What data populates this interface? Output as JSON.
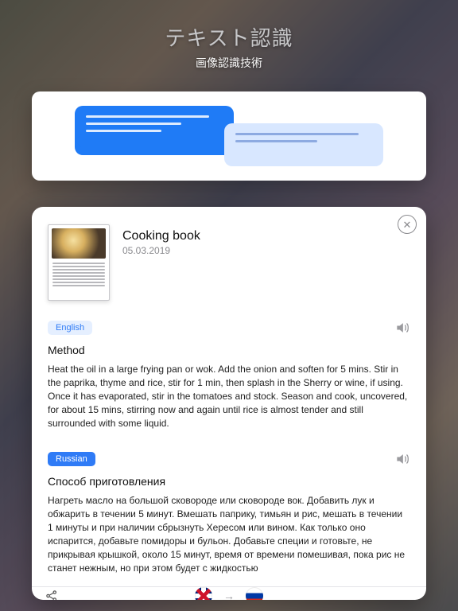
{
  "hero": {
    "title": "テキスト認識",
    "subtitle": "画像認識技術"
  },
  "document": {
    "title": "Cooking book",
    "date": "05.03.2019"
  },
  "sections": {
    "source": {
      "lang_label": "English",
      "title": "Method",
      "body": "Heat the oil in a large frying pan or wok. Add the onion and soften for 5 mins. Stir in the paprika, thyme and rice, stir for 1 min, then splash in the Sherry or wine, if using. Once it has evaporated, stir in the tomatoes and stock. Season and cook, uncovered, for about 15 mins, stirring now and again until rice is almost tender and still surrounded with some liquid."
    },
    "target": {
      "lang_label": "Russian",
      "title": "Способ приготовления",
      "body": "Нагреть масло на большой сковороде или сковороде вок. Добавить лук и обжарить в течении 5 минут. Вмешать паприку, тимьян и рис, мешать в течении 1 минуты и при наличии сбрызнуть Хересом или вином. Как только оно испарится, добавьте помидоры и бульон. Добавьте специи и готовьте, не прикрывая крышкой, около 15 минут, время от времени помешивая, пока рис не станет нежным, но при этом будет с жидкостью"
    }
  },
  "footer": {
    "source_flag": "uk",
    "target_flag": "ru"
  }
}
